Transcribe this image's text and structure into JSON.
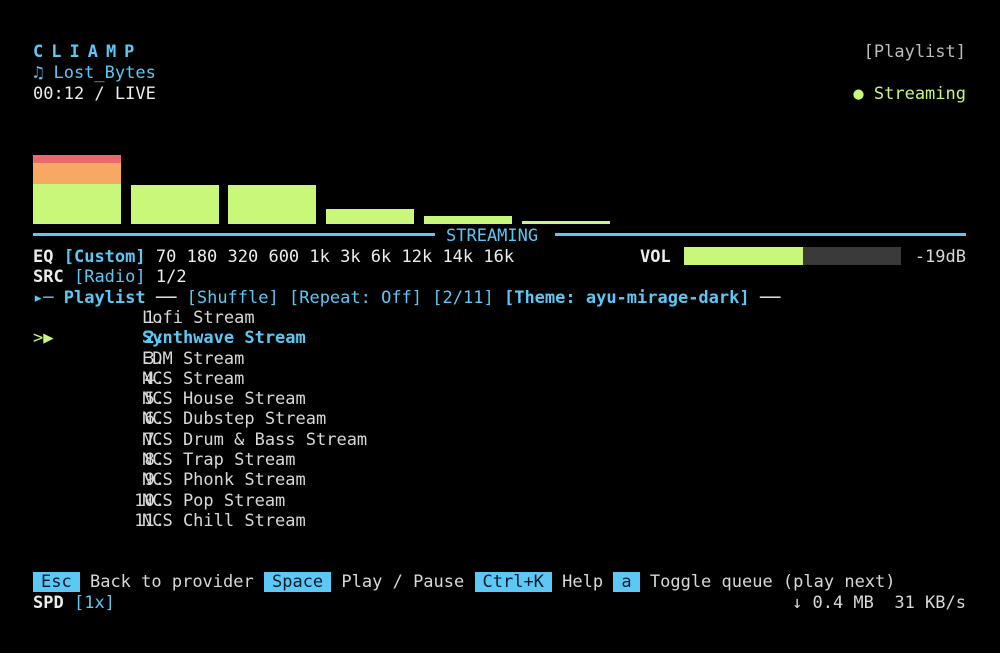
{
  "header": {
    "app_title": "CLIAMP",
    "now_playing": "♫ Lost_Bytes",
    "time_status": "00:12 / LIVE",
    "view_label": "[Playlist]",
    "stream_status": "● Streaming"
  },
  "visualizer": {
    "levels": [
      1.0,
      0.57,
      0.57,
      0.22,
      0.11,
      0.04
    ],
    "colors": {
      "low": "#c8f77a",
      "mid": "#f7a862",
      "high": "#e86a6a"
    },
    "divider_label": "STREAMING"
  },
  "eq": {
    "label": "EQ",
    "preset": "[Custom]",
    "bands": "70 180 320 600 1k 3k 6k 12k 14k 16k",
    "vol_label": "VOL",
    "vol_fraction": 0.55,
    "vol_db": "-19dB"
  },
  "source": {
    "label": "SRC",
    "value": "[Radio]",
    "position": "1/2"
  },
  "playlist_header": {
    "arrow": "▸─",
    "title": "Playlist",
    "sep": "──",
    "shuffle": "[Shuffle]",
    "repeat": "[Repeat: Off]",
    "count": "[2/11]",
    "theme": "[Theme: ayu-mirage-dark]",
    "tail": "──"
  },
  "playlist": {
    "cursor": ">▶",
    "items": [
      {
        "num": "1.",
        "name": "Lofi Stream"
      },
      {
        "num": "2.",
        "name": "Synthwave Stream",
        "current": true
      },
      {
        "num": "3.",
        "name": "EDM Stream"
      },
      {
        "num": "4.",
        "name": "NCS Stream"
      },
      {
        "num": "5.",
        "name": "NCS House Stream"
      },
      {
        "num": "6.",
        "name": "NCS Dubstep Stream"
      },
      {
        "num": "7.",
        "name": "NCS Drum & Bass Stream"
      },
      {
        "num": "8.",
        "name": "NCS Trap Stream"
      },
      {
        "num": "9.",
        "name": "NCS Phonk Stream"
      },
      {
        "num": "10.",
        "name": "NCS Pop Stream"
      },
      {
        "num": "11.",
        "name": "NCS Chill Stream"
      }
    ]
  },
  "footer": {
    "keys": [
      {
        "key": "Esc",
        "action": "Back to provider"
      },
      {
        "key": "Space",
        "action": "Play / Pause"
      },
      {
        "key": "Ctrl+K",
        "action": "Help"
      },
      {
        "key": "a",
        "action": "Toggle queue (play next)"
      }
    ],
    "spd_label": "SPD",
    "spd_value": "[1x]",
    "net_stats": "↓ 0.4 MB  31 KB/s"
  },
  "colors": {
    "accent": "#5cc8f5",
    "green": "#c8f77a",
    "background": "#000000"
  }
}
